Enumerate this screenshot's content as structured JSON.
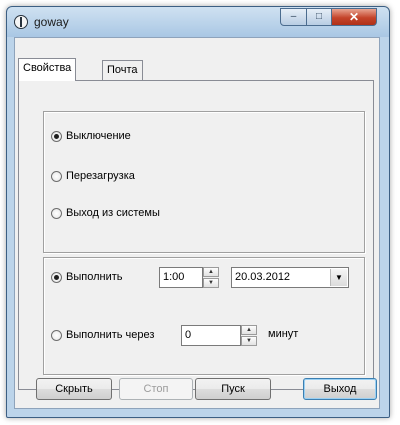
{
  "window": {
    "title": "goway"
  },
  "titlebar": {
    "minimize_glyph": "–",
    "maximize_glyph": "□",
    "close_glyph": "✕"
  },
  "tabs": [
    {
      "label": "Свойства",
      "active": true
    },
    {
      "label": "Почта",
      "active": false
    }
  ],
  "actions": {
    "options": [
      {
        "label": "Выключение",
        "checked": true
      },
      {
        "label": "Перезагрузка",
        "checked": false
      },
      {
        "label": "Выход из системы",
        "checked": false
      }
    ]
  },
  "schedule": {
    "at": {
      "label": "Выполнить",
      "checked": true,
      "time": "1:00",
      "date": "20.03.2012"
    },
    "after": {
      "label": "Выполнить через",
      "checked": false,
      "value": "0",
      "unit": "минут"
    }
  },
  "spin_glyphs": {
    "up": "▲",
    "down": "▼"
  },
  "combo_glyph": "▼",
  "buttons": {
    "hide": "Скрыть",
    "stop": "Стоп",
    "start": "Пуск",
    "exit": "Выход"
  }
}
